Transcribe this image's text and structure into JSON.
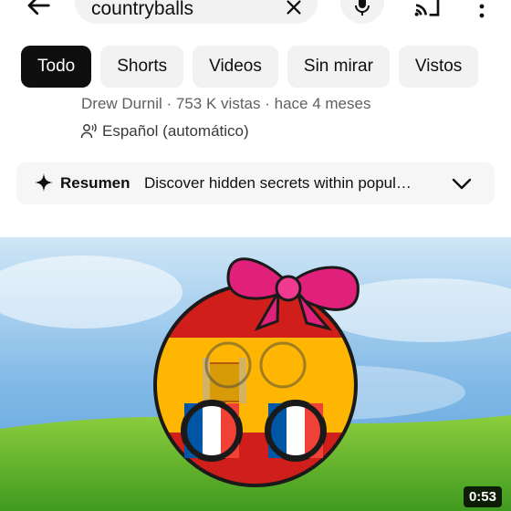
{
  "search": {
    "query": "countryballs"
  },
  "icons": {
    "back": "arrow-left-icon",
    "clear": "close-icon",
    "mic": "microphone-icon",
    "cast": "cast-icon",
    "more": "more-vertical-icon",
    "language": "person-voice-icon",
    "summary": "sparkle-icon",
    "expand": "chevron-down-icon"
  },
  "filters": [
    {
      "label": "Todo",
      "active": true
    },
    {
      "label": "Shorts",
      "active": false
    },
    {
      "label": "Videos",
      "active": false
    },
    {
      "label": "Sin mirar",
      "active": false
    },
    {
      "label": "Vistos",
      "active": false
    }
  ],
  "video": {
    "meta": "Drew Durnil · 753 K vistas · hace 4 meses",
    "language": "Español (automático)",
    "summary_label": "Resumen",
    "summary_text": "Discover hidden secrets within popul…",
    "duration": "0:53"
  },
  "colors": {
    "active_chip": "#0f0f0f",
    "chip_bg": "#f2f2f2",
    "bow": "#e0207a",
    "spain_red": "#c60b1e",
    "spain_yellow": "#ffc400"
  }
}
